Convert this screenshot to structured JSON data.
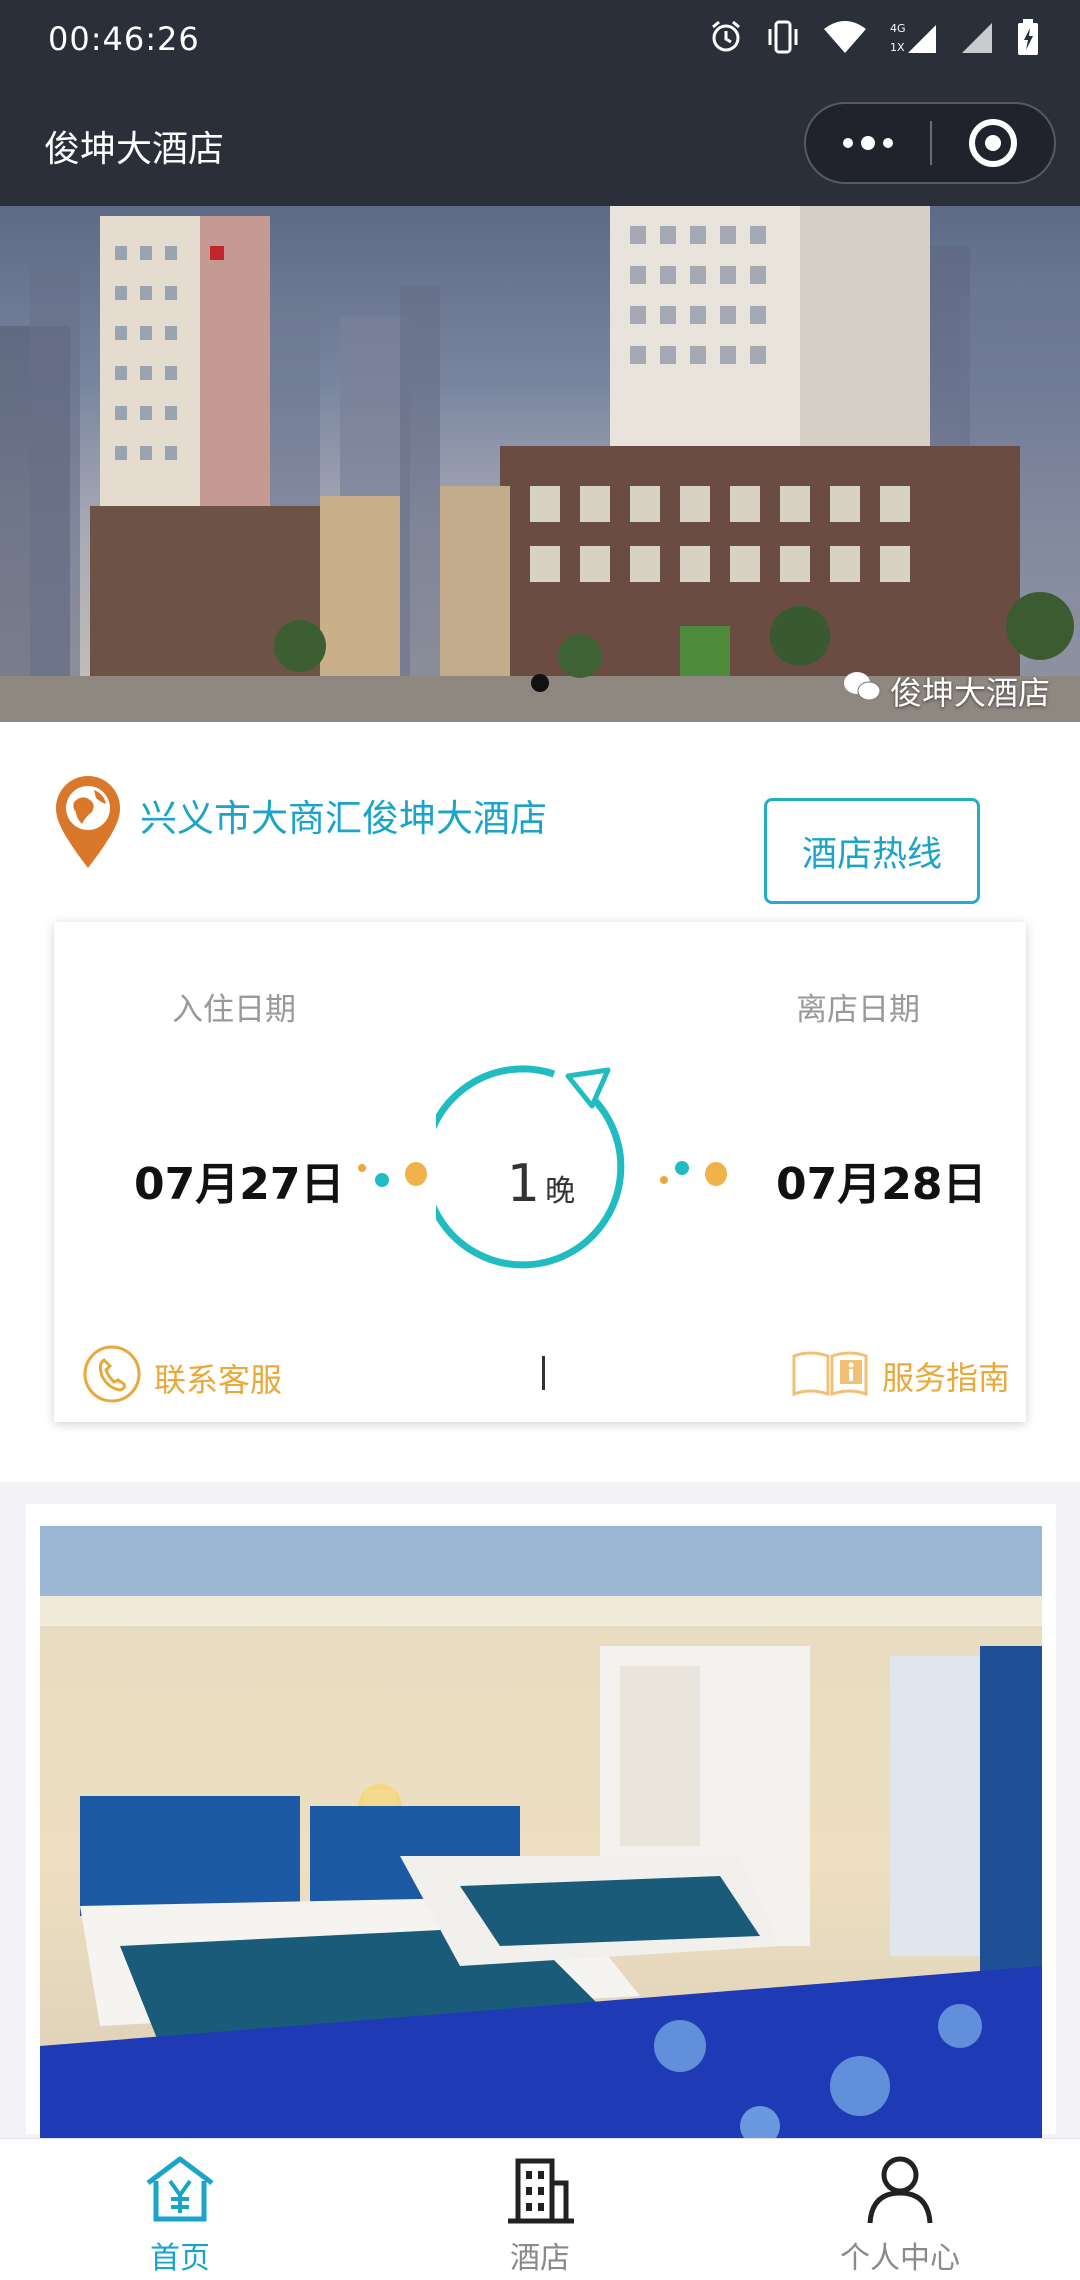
{
  "status": {
    "time": "00:46:26"
  },
  "nav": {
    "title": "俊坤大酒店"
  },
  "banner": {
    "watermark": "俊坤大酒店",
    "slides": 1,
    "active_index": 0
  },
  "hotel": {
    "name": "兴义市大商汇俊坤大酒店",
    "hotline_label": "酒店热线"
  },
  "booking": {
    "checkin_label": "入住日期",
    "checkout_label": "离店日期",
    "checkin_date": "07月27日",
    "checkout_date": "07月28日",
    "nights": "1",
    "nights_unit": "晚",
    "contact_label": "联系客服",
    "guide_label": "服务指南"
  },
  "tabs": [
    {
      "label": "首页",
      "icon": "home-yuan-icon",
      "active": true
    },
    {
      "label": "酒店",
      "icon": "building-icon",
      "active": false
    },
    {
      "label": "个人中心",
      "icon": "person-icon",
      "active": false
    }
  ],
  "colors": {
    "accent": "#1aa4c8",
    "teal": "#1fbcc2",
    "orange": "#e8a93a",
    "pin_orange": "#d9782a",
    "header_bg": "#2b2f3a",
    "tab_active": "#1aa4c8",
    "tab_inactive": "#8a8a8a"
  }
}
